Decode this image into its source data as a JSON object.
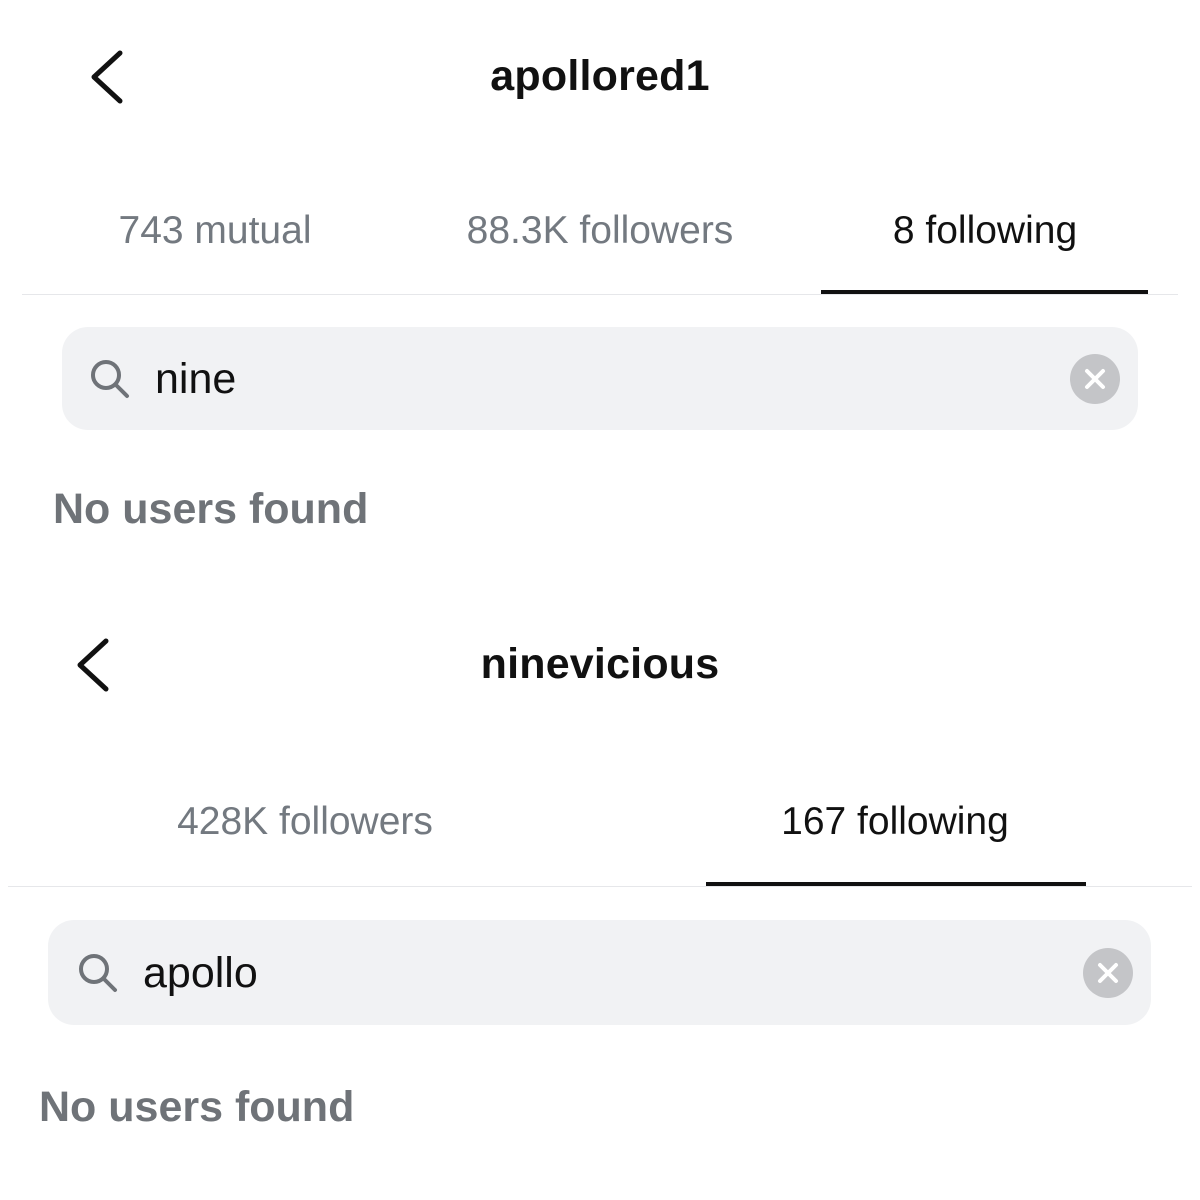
{
  "screens": [
    {
      "title": "apollored1",
      "tabs": [
        {
          "label": "743 mutual",
          "active": false
        },
        {
          "label": "88.3K followers",
          "active": false
        },
        {
          "label": "8 following",
          "active": true
        }
      ],
      "search": {
        "value": "nine"
      },
      "empty_message": "No users found"
    },
    {
      "title": "ninevicious",
      "tabs": [
        {
          "label": "428K followers",
          "active": false
        },
        {
          "label": "167 following",
          "active": true
        }
      ],
      "search": {
        "value": "apollo"
      },
      "empty_message": "No users found"
    }
  ],
  "icons": {
    "back": "chevron-left-icon",
    "search": "magnifier-icon",
    "clear": "close-circle-icon"
  },
  "colors": {
    "active_text": "#111111",
    "inactive_text": "#737980",
    "search_background": "#f1f2f4",
    "clear_button": "#c4c5c8",
    "empty_text": "#6f7378"
  }
}
